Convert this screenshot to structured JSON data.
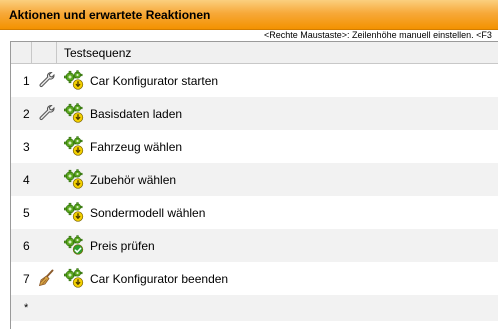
{
  "panel": {
    "title": "Aktionen und erwartete Reaktionen",
    "hint": "<Rechte Maustaste>: Zeilenhöhe manuell einstellen.  <F3"
  },
  "table": {
    "column_header": "Testsequenz",
    "rows": [
      {
        "number": "1",
        "tool_icon": "wrench-icon",
        "step_icon": "gear-arrow-icon",
        "label": "Car Konfigurator starten"
      },
      {
        "number": "2",
        "tool_icon": "wrench-icon",
        "step_icon": "gear-arrow-icon",
        "label": "Basisdaten laden"
      },
      {
        "number": "3",
        "tool_icon": "",
        "step_icon": "gear-arrow-icon",
        "label": "Fahrzeug wählen"
      },
      {
        "number": "4",
        "tool_icon": "",
        "step_icon": "gear-arrow-icon",
        "label": "Zubehör wählen"
      },
      {
        "number": "5",
        "tool_icon": "",
        "step_icon": "gear-arrow-icon",
        "label": "Sondermodell wählen"
      },
      {
        "number": "6",
        "tool_icon": "",
        "step_icon": "gear-check-icon",
        "label": "Preis prüfen"
      },
      {
        "number": "7",
        "tool_icon": "broom-icon",
        "step_icon": "gear-arrow-icon",
        "label": "Car Konfigurator beenden"
      }
    ],
    "new_row_marker": "*"
  },
  "colors": {
    "title_gradient_top": "#fbcf7f",
    "title_gradient_bottom": "#f39200",
    "gear_green": "#5aa61e",
    "badge_yellow": "#f4d000",
    "badge_check_green": "#2e9e2e",
    "row_alt": "#f2f2f2"
  }
}
